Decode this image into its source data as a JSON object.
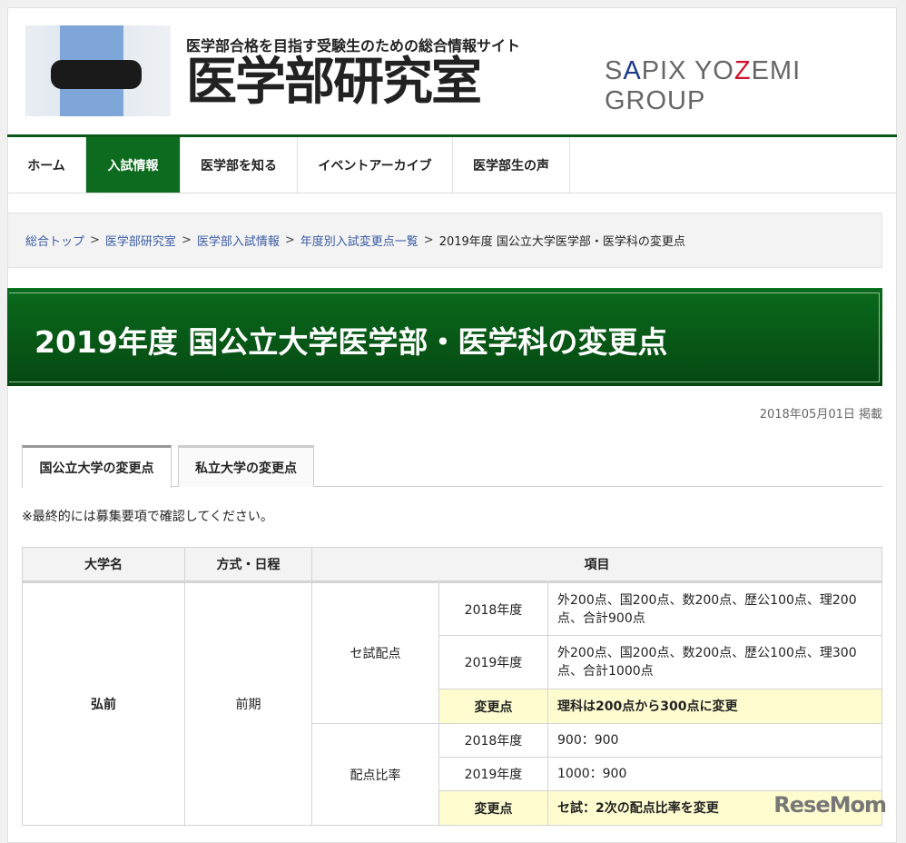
{
  "header": {
    "tagline": "医学部合格を目指す受験生のための総合情報サイト",
    "site_title": "医学部研究室",
    "group_logo": "SAPIX YOZEMI GROUP"
  },
  "nav": [
    {
      "label": "ホーム"
    },
    {
      "label": "入試情報",
      "active": true
    },
    {
      "label": "医学部を知る"
    },
    {
      "label": "イベントアーカイブ"
    },
    {
      "label": "医学部生の声"
    }
  ],
  "breadcrumb": [
    "総合トップ",
    "医学部研究室",
    "医学部入試情報",
    "年度別入試変更点一覧",
    "2019年度 国公立大学医学部・医学科の変更点"
  ],
  "page_title": "2019年度 国公立大学医学部・医学科の変更点",
  "published": "2018年05月01日 掲載",
  "tabs": [
    {
      "label": "国公立大学の変更点",
      "active": true
    },
    {
      "label": "私立大学の変更点"
    }
  ],
  "note": "※最終的には募集要項で確認してください。",
  "table": {
    "headers": [
      "大学名",
      "方式・日程",
      "項目"
    ],
    "university": "弘前",
    "schedule": "前期",
    "groups": [
      {
        "item": "セ試配点",
        "rows": [
          {
            "label": "2018年度",
            "value": "外200点、国200点、数200点、歴公100点、理200点、合計900点"
          },
          {
            "label": "2019年度",
            "value": "外200点、国200点、数200点、歴公100点、理300点、合計1000点"
          },
          {
            "label": "変更点",
            "value": "理科は200点から300点に変更"
          }
        ]
      },
      {
        "item": "配点比率",
        "rows": [
          {
            "label": "2018年度",
            "value": "900：900"
          },
          {
            "label": "2019年度",
            "value": "1000：900"
          },
          {
            "label": "変更点",
            "value": "セ試：2次の配点比率を変更"
          }
        ]
      }
    ]
  },
  "watermark": "ReseMom"
}
